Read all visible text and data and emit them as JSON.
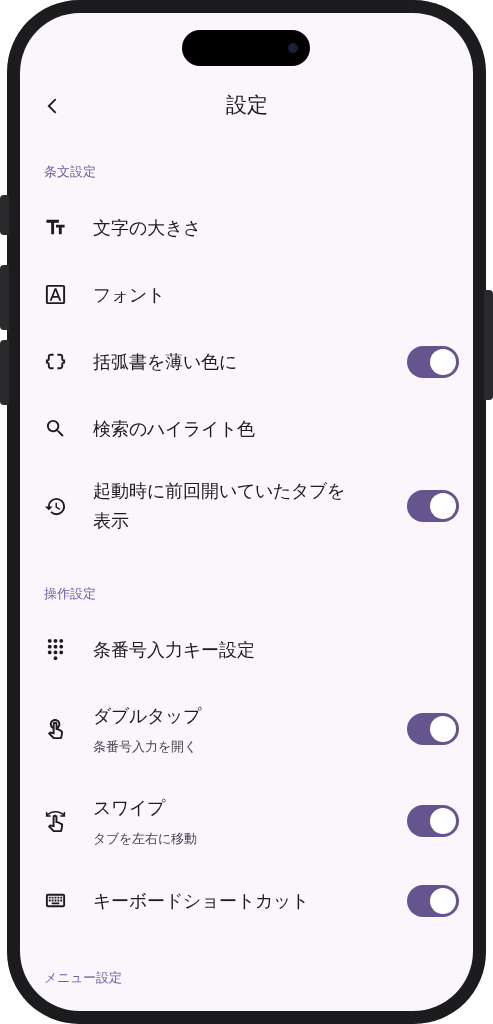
{
  "header": {
    "title": "設定"
  },
  "sections": [
    {
      "title": "条文設定",
      "items": [
        {
          "label": "文字の大きさ",
          "kind": "link"
        },
        {
          "label": "フォント",
          "kind": "link"
        },
        {
          "label": "括弧書を薄い色に",
          "kind": "toggle",
          "on": true
        },
        {
          "label": "検索のハイライト色",
          "kind": "link"
        },
        {
          "label": "起動時に前回開いていたタブを表示",
          "kind": "toggle",
          "on": true
        }
      ]
    },
    {
      "title": "操作設定",
      "items": [
        {
          "label": "条番号入力キー設定",
          "kind": "link"
        },
        {
          "label": "ダブルタップ",
          "subtitle": "条番号入力を開く",
          "kind": "toggle",
          "on": true
        },
        {
          "label": "スワイプ",
          "subtitle": "タブを左右に移動",
          "kind": "toggle",
          "on": true
        },
        {
          "label": "キーボードショートカット",
          "kind": "toggle",
          "on": true
        }
      ]
    },
    {
      "title": "メニュー設定"
    }
  ]
}
